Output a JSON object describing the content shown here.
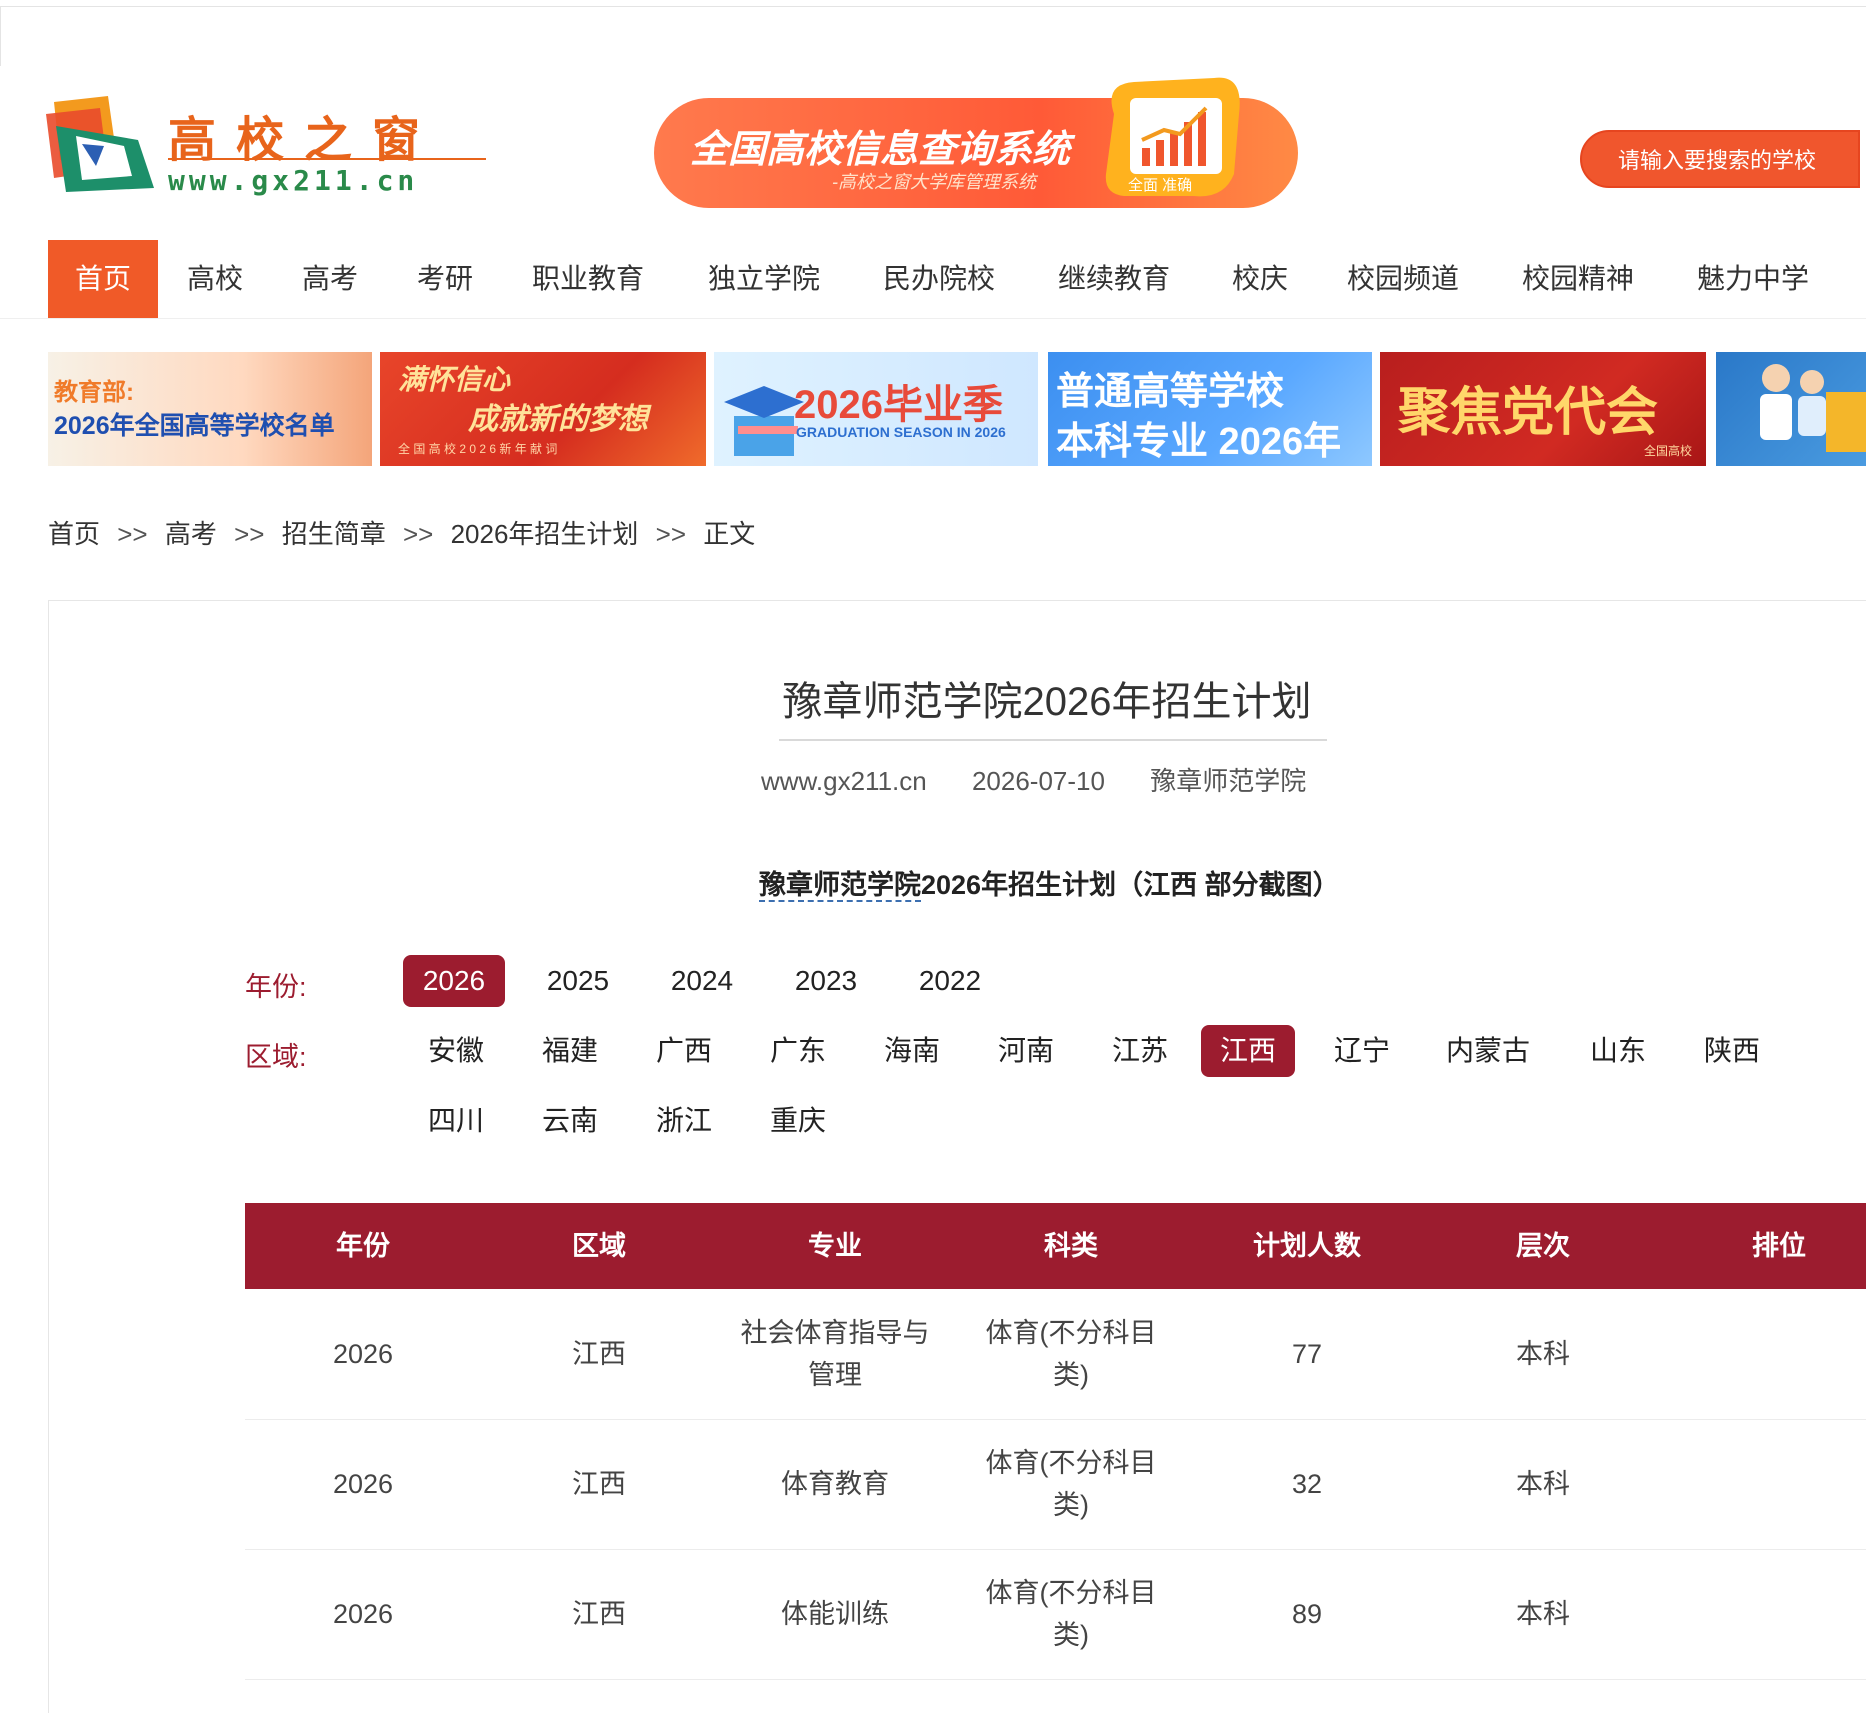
{
  "logo": {
    "title": "高校之窗",
    "url": "www.gx211.cn"
  },
  "banner": {
    "title": "全国高校信息查询系统",
    "subtitle": "-高校之窗大学库管理系统",
    "tag": "全面 准确"
  },
  "search": {
    "label": "请输入要搜索的学校"
  },
  "nav": {
    "items": [
      "首页",
      "高校",
      "高考",
      "考研",
      "职业教育",
      "独立学院",
      "民办院校",
      "继续教育",
      "校庆",
      "校园频道",
      "校园精神",
      "魅力中学"
    ]
  },
  "promos": {
    "p1_line1": "教育部:",
    "p1_line2": "2026年全国高等学校名单",
    "p2_line1": "满怀信心",
    "p2_line2": "成就新的梦想",
    "p2_small": "全 国 高 校 2 0 2 6 新 年 献 词",
    "p3_line1": "2026毕业季",
    "p3_line2": "GRADUATION SEASON IN 2026",
    "p4_line1": "普通高等学校",
    "p4_line2": "本科专业 2026年",
    "p5_line1": "聚焦党代会",
    "p5_small": "全国高校"
  },
  "breadcrumb": {
    "items": [
      "首页",
      "高考",
      "招生简章",
      "2026年招生计划",
      "正文"
    ],
    "sep": ">>"
  },
  "article": {
    "title": "豫章师范学院2026年招生计划",
    "source": "www.gx211.cn",
    "date": "2026-07-10",
    "author": "豫章师范学院",
    "subhead_link": "豫章师范学院",
    "subhead_rest": "2026年招生计划（江西 部分截图）"
  },
  "filters": {
    "year_label": "年份:",
    "years": [
      "2026",
      "2025",
      "2024",
      "2023",
      "2022"
    ],
    "region_label": "区域:",
    "regions": [
      "安徽",
      "福建",
      "广西",
      "广东",
      "海南",
      "河南",
      "江苏",
      "江西",
      "辽宁",
      "内蒙古",
      "山东",
      "陕西",
      "四川",
      "云南",
      "浙江",
      "重庆"
    ]
  },
  "table": {
    "headers": [
      "年份",
      "区域",
      "专业",
      "科类",
      "计划人数",
      "层次",
      "排位"
    ],
    "rows": [
      [
        "2026",
        "江西",
        "社会体育指导与管理",
        "体育(不分科目类)",
        "77",
        "本科",
        ""
      ],
      [
        "2026",
        "江西",
        "体育教育",
        "体育(不分科目类)",
        "32",
        "本科",
        ""
      ],
      [
        "2026",
        "江西",
        "体能训练",
        "体育(不分科目类)",
        "89",
        "本科",
        ""
      ]
    ]
  },
  "colors": {
    "accent": "#f05a28",
    "maroon": "#9c1c2f"
  }
}
